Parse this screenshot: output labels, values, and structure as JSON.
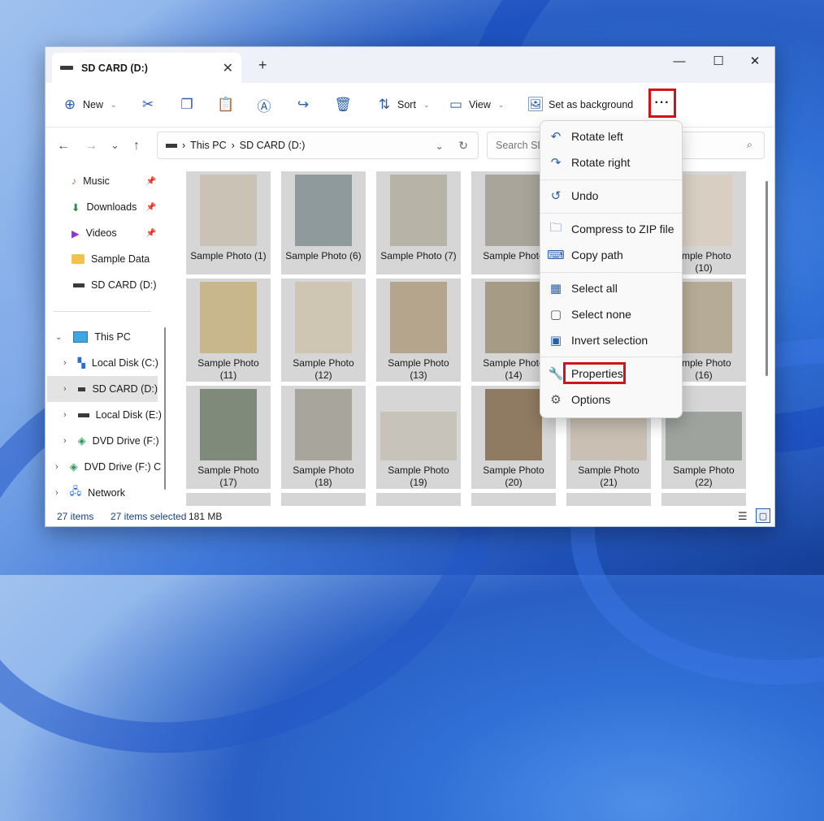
{
  "window": {
    "tab_title": "SD CARD (D:)",
    "minimize": "—",
    "maximize": "☐",
    "close": "✕"
  },
  "toolbar": {
    "new_label": "New",
    "sort_label": "Sort",
    "view_label": "View",
    "set_bg_label": "Set as background",
    "more_label": "···"
  },
  "address": {
    "segments": [
      "This PC",
      "SD CARD (D:)"
    ],
    "search_placeholder": "Search SD C"
  },
  "sidebar": {
    "quick": [
      {
        "label": "Music",
        "icon": "music-icon",
        "pinned": true
      },
      {
        "label": "Downloads",
        "icon": "download-icon",
        "pinned": true
      },
      {
        "label": "Videos",
        "icon": "video-icon",
        "pinned": true
      },
      {
        "label": "Sample Data",
        "icon": "folder-icon",
        "pinned": false
      },
      {
        "label": "SD CARD (D:)",
        "icon": "drive-icon",
        "pinned": false
      }
    ],
    "tree": [
      {
        "label": "This PC",
        "icon": "pc-icon"
      },
      {
        "label": "Local Disk (C:)",
        "icon": "windows-drive-icon"
      },
      {
        "label": "SD CARD (D:)",
        "icon": "drive-icon"
      },
      {
        "label": "Local Disk (E:)",
        "icon": "drive-icon"
      },
      {
        "label": "DVD Drive (F:)",
        "icon": "dvd-icon"
      },
      {
        "label": "DVD Drive (F:) C",
        "icon": "dvd-icon"
      },
      {
        "label": "Network",
        "icon": "network-icon"
      }
    ]
  },
  "photos": [
    [
      "Sample Photo (1)",
      ""
    ],
    [
      "Sample Photo (6)",
      ""
    ],
    [
      "Sample Photo (7)",
      ""
    ],
    [
      "Sample Photo",
      ""
    ],
    [
      "",
      ""
    ],
    [
      "ample Photo",
      "(10)"
    ],
    [
      "Sample Photo",
      "(11)"
    ],
    [
      "Sample Photo",
      "(12)"
    ],
    [
      "Sample Photo",
      "(13)"
    ],
    [
      "Sample Photo",
      "(14)"
    ],
    [
      "",
      ""
    ],
    [
      "ample Photo",
      "(16)"
    ],
    [
      "Sample Photo",
      "(17)"
    ],
    [
      "Sample Photo",
      "(18)"
    ],
    [
      "Sample Photo",
      "(19)"
    ],
    [
      "Sample Photo",
      "(20)"
    ],
    [
      "Sample Photo",
      "(21)"
    ],
    [
      "Sample Photo",
      "(22)"
    ]
  ],
  "context_menu": {
    "items": [
      "Rotate left",
      "Rotate right",
      "Undo",
      "Compress to ZIP file",
      "Copy path",
      "Select all",
      "Select none",
      "Invert selection",
      "Properties",
      "Options"
    ]
  },
  "status": {
    "count": "27 items",
    "selected": "27 items selected",
    "size": "181 MB"
  },
  "colors": {
    "accent": "#2a5ea8",
    "highlight": "#d0141b"
  }
}
